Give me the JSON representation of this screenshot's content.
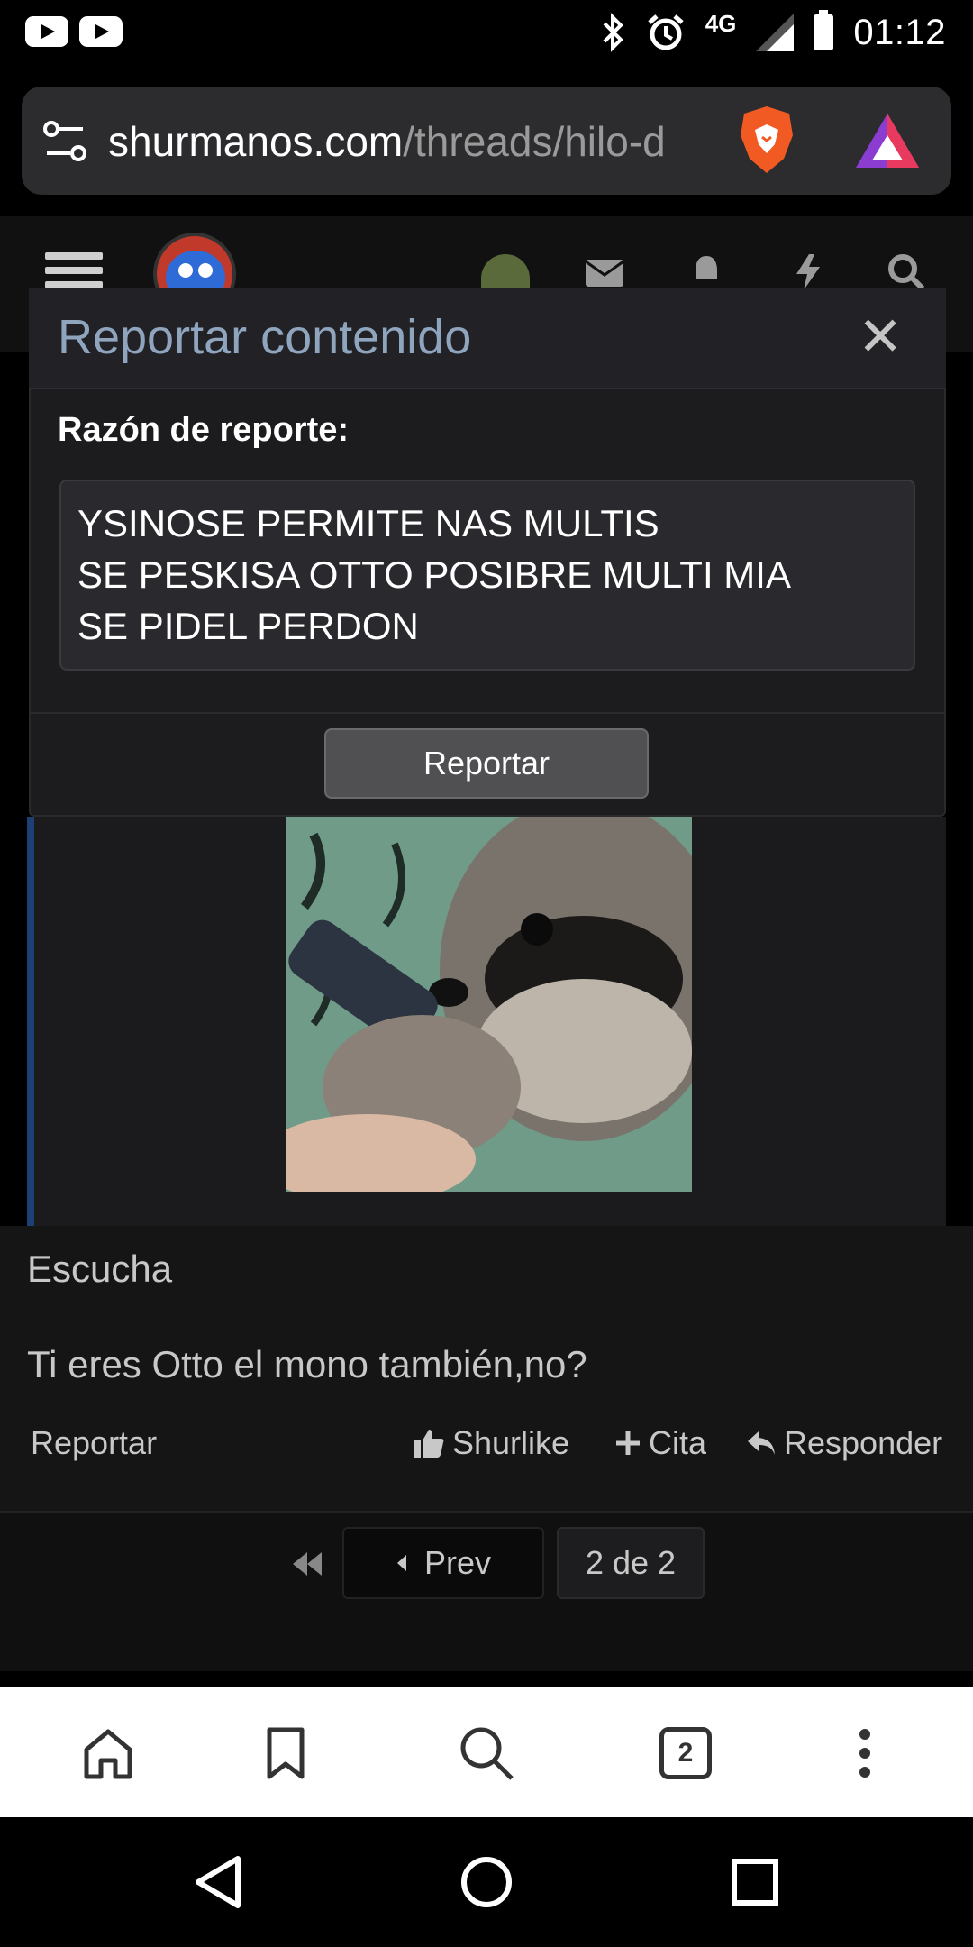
{
  "status_bar": {
    "network": "4G",
    "time": "01:12"
  },
  "browser": {
    "url_domain": "shurmanos.com",
    "url_path": "/threads/hilo-d",
    "tab_count": "2"
  },
  "modal": {
    "title": "Reportar contenido",
    "close_glyph": "✕",
    "reason_label": "Razón de reporte:",
    "reason_text": "YSINOSE PERMITE NAS MULTIS\nSE PESKISA OTTO POSIBRE MULTI MIA\nSE PIDEL PERDON",
    "submit_label": "Reportar"
  },
  "post": {
    "line1": "Escucha",
    "line2": "Ti eres Otto el mono también,no?",
    "actions": {
      "report": "Reportar",
      "like": "Shurlike",
      "quote": "Cita",
      "reply": "Responder"
    }
  },
  "pager": {
    "prev": "Prev",
    "count": "2 de 2"
  },
  "colors": {
    "modal_title": "#8fa4bd",
    "quote_border": "#1e3f73"
  }
}
